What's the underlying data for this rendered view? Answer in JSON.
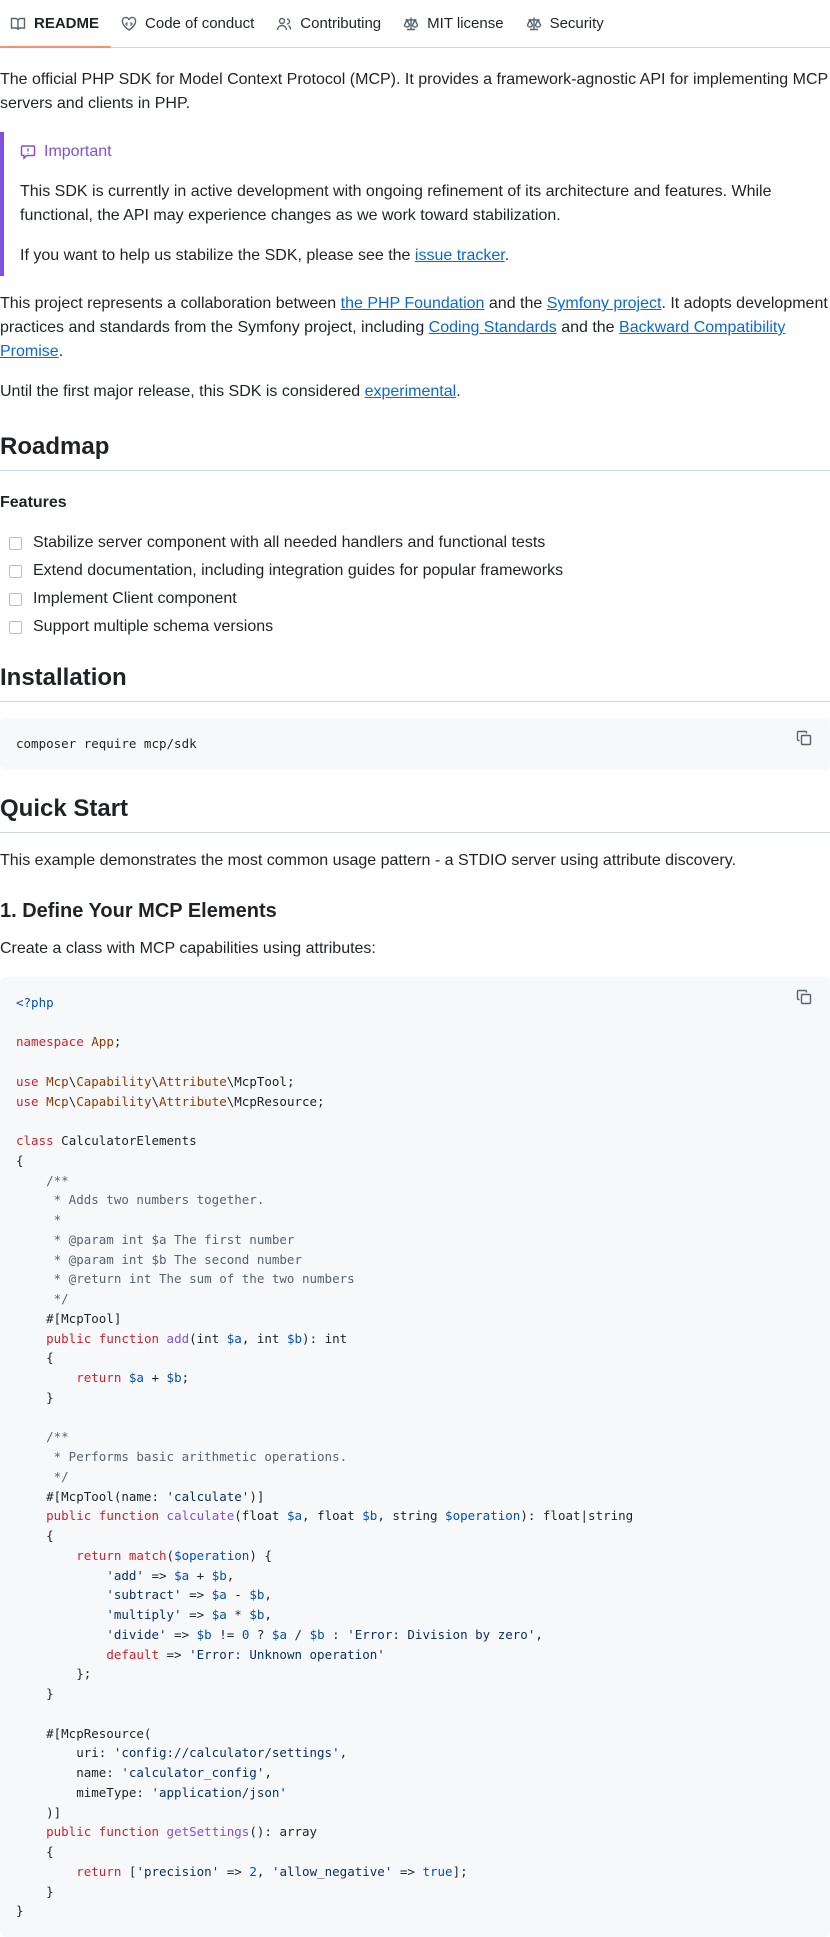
{
  "tabs": [
    {
      "label": "README",
      "icon": "book-icon"
    },
    {
      "label": "Code of conduct",
      "icon": "heart-code-icon"
    },
    {
      "label": "Contributing",
      "icon": "people-icon"
    },
    {
      "label": "MIT license",
      "icon": "law-icon"
    },
    {
      "label": "Security",
      "icon": "law-icon"
    }
  ],
  "intro": "The official PHP SDK for Model Context Protocol (MCP). It provides a framework-agnostic API for implementing MCP servers and clients in PHP.",
  "alert": {
    "title": "Important",
    "text1": "This SDK is currently in active development with ongoing refinement of its architecture and features. While functional, the API may experience changes as we work toward stabilization.",
    "text2_pre": "If you want to help us stabilize the SDK, please see the ",
    "text2_link": "issue tracker",
    "text2_post": "."
  },
  "collab": {
    "t1": "This project represents a collaboration between ",
    "link1": "the PHP Foundation",
    "t2": " and the ",
    "link2": "Symfony project",
    "t3": ". It adopts development practices and standards from the Symfony project, including ",
    "link3": "Coding Standards",
    "t4": " and the ",
    "link4": "Backward Compatibility Promise",
    "t5": "."
  },
  "experimental": {
    "pre": "Until the first major release, this SDK is considered ",
    "link": "experimental",
    "post": "."
  },
  "roadmap": {
    "heading": "Roadmap",
    "features_heading": "Features",
    "tasks": [
      "Stabilize server component with all needed handlers and functional tests",
      "Extend documentation, including integration guides for popular frameworks",
      "Implement Client component",
      "Support multiple schema versions"
    ]
  },
  "installation": {
    "heading": "Installation",
    "command": "composer require mcp/sdk"
  },
  "quickstart": {
    "heading": "Quick Start",
    "text": "This example demonstrates the most common usage pattern - a STDIO server using attribute discovery.",
    "step1_heading": "1. Define Your MCP Elements",
    "step1_text": "Create a class with MCP capabilities using attributes:"
  },
  "code": {
    "open_tag": "<?php",
    "namespace_kw": "namespace",
    "namespace_name": "App",
    "use1": "Mcp\\Capability\\Attribute\\McpTool",
    "use2": "Mcp\\Capability\\Attribute\\McpResource",
    "class_name": "CalculatorElements"
  }
}
